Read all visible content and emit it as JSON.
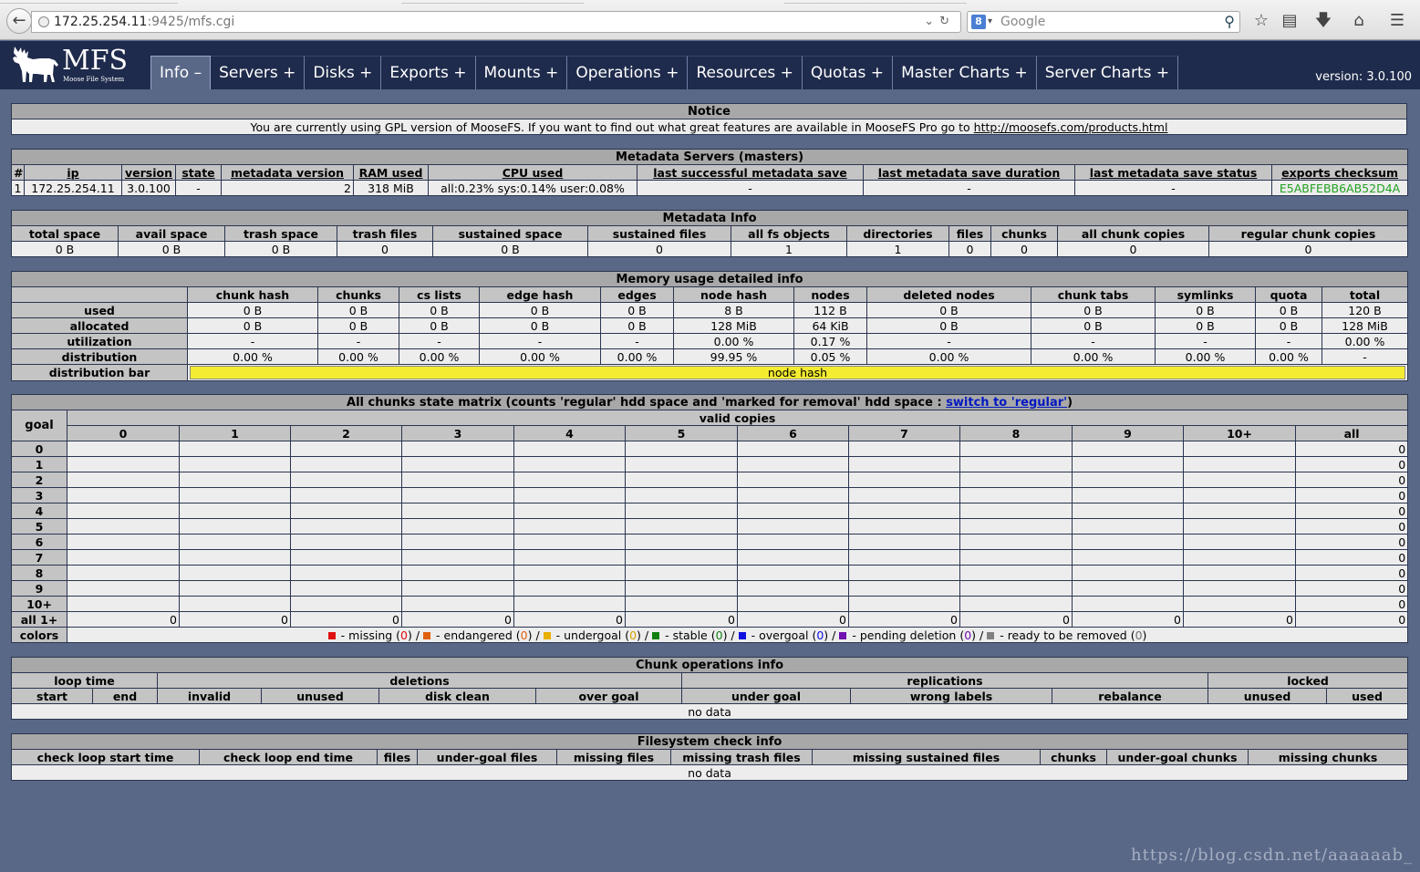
{
  "browser": {
    "url_host": "172.25.254.11",
    "url_rest": ":9425/mfs.cgi",
    "search_placeholder": "Google"
  },
  "header": {
    "logo_text": "MFS",
    "logo_sub": "Moose File System",
    "version": "version: 3.0.100",
    "nav": [
      {
        "label": "Info –",
        "active": true
      },
      {
        "label": "Servers +"
      },
      {
        "label": "Disks +"
      },
      {
        "label": "Exports +"
      },
      {
        "label": "Mounts +"
      },
      {
        "label": "Operations +"
      },
      {
        "label": "Resources +"
      },
      {
        "label": "Quotas +"
      },
      {
        "label": "Master Charts +"
      },
      {
        "label": "Server Charts +"
      }
    ]
  },
  "notice": {
    "title": "Notice",
    "text": "You are currently using GPL version of MooseFS. If you want to find out what great features are available in MooseFS Pro go to ",
    "link": "http://moosefs.com/products.html"
  },
  "masters": {
    "title": "Metadata Servers (masters)",
    "headers": [
      "#",
      "ip",
      "version",
      "state",
      "metadata version",
      "RAM used",
      "CPU used",
      "last successful metadata save",
      "last metadata save duration",
      "last metadata save status",
      "exports checksum"
    ],
    "row": [
      "1",
      "172.25.254.11",
      "3.0.100",
      "-",
      "2",
      "318 MiB",
      "all:0.23% sys:0.14% user:0.08%",
      "-",
      "-",
      "-",
      "E5ABFEBB6AB52D4A"
    ]
  },
  "metadata": {
    "title": "Metadata Info",
    "headers": [
      "total space",
      "avail space",
      "trash space",
      "trash files",
      "sustained space",
      "sustained files",
      "all fs objects",
      "directories",
      "files",
      "chunks",
      "all chunk copies",
      "regular chunk copies"
    ],
    "row": [
      "0 B",
      "0 B",
      "0 B",
      "0",
      "0 B",
      "0",
      "1",
      "1",
      "0",
      "0",
      "0",
      "0"
    ]
  },
  "memory": {
    "title": "Memory usage detailed info",
    "headers": [
      "chunk hash",
      "chunks",
      "cs lists",
      "edge hash",
      "edges",
      "node hash",
      "nodes",
      "deleted nodes",
      "chunk tabs",
      "symlinks",
      "quota",
      "total"
    ],
    "rows": [
      {
        "label": "used",
        "cells": [
          "0 B",
          "0 B",
          "0 B",
          "0 B",
          "0 B",
          "8 B",
          "112 B",
          "0 B",
          "0 B",
          "0 B",
          "0 B",
          "120 B"
        ]
      },
      {
        "label": "allocated",
        "cells": [
          "0 B",
          "0 B",
          "0 B",
          "0 B",
          "0 B",
          "128 MiB",
          "64 KiB",
          "0 B",
          "0 B",
          "0 B",
          "0 B",
          "128 MiB"
        ]
      },
      {
        "label": "utilization",
        "cells": [
          "-",
          "-",
          "-",
          "-",
          "-",
          "0.00 %",
          "0.17 %",
          "-",
          "-",
          "-",
          "-",
          "0.00 %"
        ]
      },
      {
        "label": "distribution",
        "cells": [
          "0.00 %",
          "0.00 %",
          "0.00 %",
          "0.00 %",
          "0.00 %",
          "99.95 %",
          "0.05 %",
          "0.00 %",
          "0.00 %",
          "0.00 %",
          "0.00 %",
          "-"
        ]
      }
    ],
    "bar_label": "distribution bar",
    "bar_text": "node hash"
  },
  "matrix": {
    "title_pre": "All chunks state matrix (counts 'regular' hdd space and 'marked for removal' hdd space : ",
    "title_link": "switch to 'regular'",
    "title_post": ")",
    "goal_label": "goal",
    "valid_copies_label": "valid copies",
    "columns": [
      "0",
      "1",
      "2",
      "3",
      "4",
      "5",
      "6",
      "7",
      "8",
      "9",
      "10+",
      "all"
    ],
    "goals": [
      "0",
      "1",
      "2",
      "3",
      "4",
      "5",
      "6",
      "7",
      "8",
      "9",
      "10+"
    ],
    "all_label": "all 1+",
    "colors_label": "colors",
    "legend": [
      {
        "label": "missing",
        "count": "0",
        "color": "#e01010"
      },
      {
        "label": "endangered",
        "count": "0",
        "color": "#e06010"
      },
      {
        "label": "undergoal",
        "count": "0",
        "color": "#e8b000"
      },
      {
        "label": "stable",
        "count": "0",
        "color": "#108010"
      },
      {
        "label": "overgoal",
        "count": "0",
        "color": "#1010e0"
      },
      {
        "label": "pending deletion",
        "count": "0",
        "color": "#7010b0"
      },
      {
        "label": "ready to be removed",
        "count": "0",
        "color": "#808080"
      }
    ]
  },
  "chunkops": {
    "title": "Chunk operations info",
    "groups": [
      "loop time",
      "deletions",
      "replications",
      "locked"
    ],
    "headers": [
      "start",
      "end",
      "invalid",
      "unused",
      "disk clean",
      "over goal",
      "under goal",
      "wrong labels",
      "rebalance",
      "unused",
      "used"
    ],
    "empty": "no data"
  },
  "fscheck": {
    "title": "Filesystem check info",
    "headers": [
      "check loop start time",
      "check loop end time",
      "files",
      "under-goal files",
      "missing files",
      "missing trash files",
      "missing sustained files",
      "chunks",
      "under-goal chunks",
      "missing chunks"
    ],
    "empty": "no data"
  },
  "watermark": "https://blog.csdn.net/aaaaaab_"
}
